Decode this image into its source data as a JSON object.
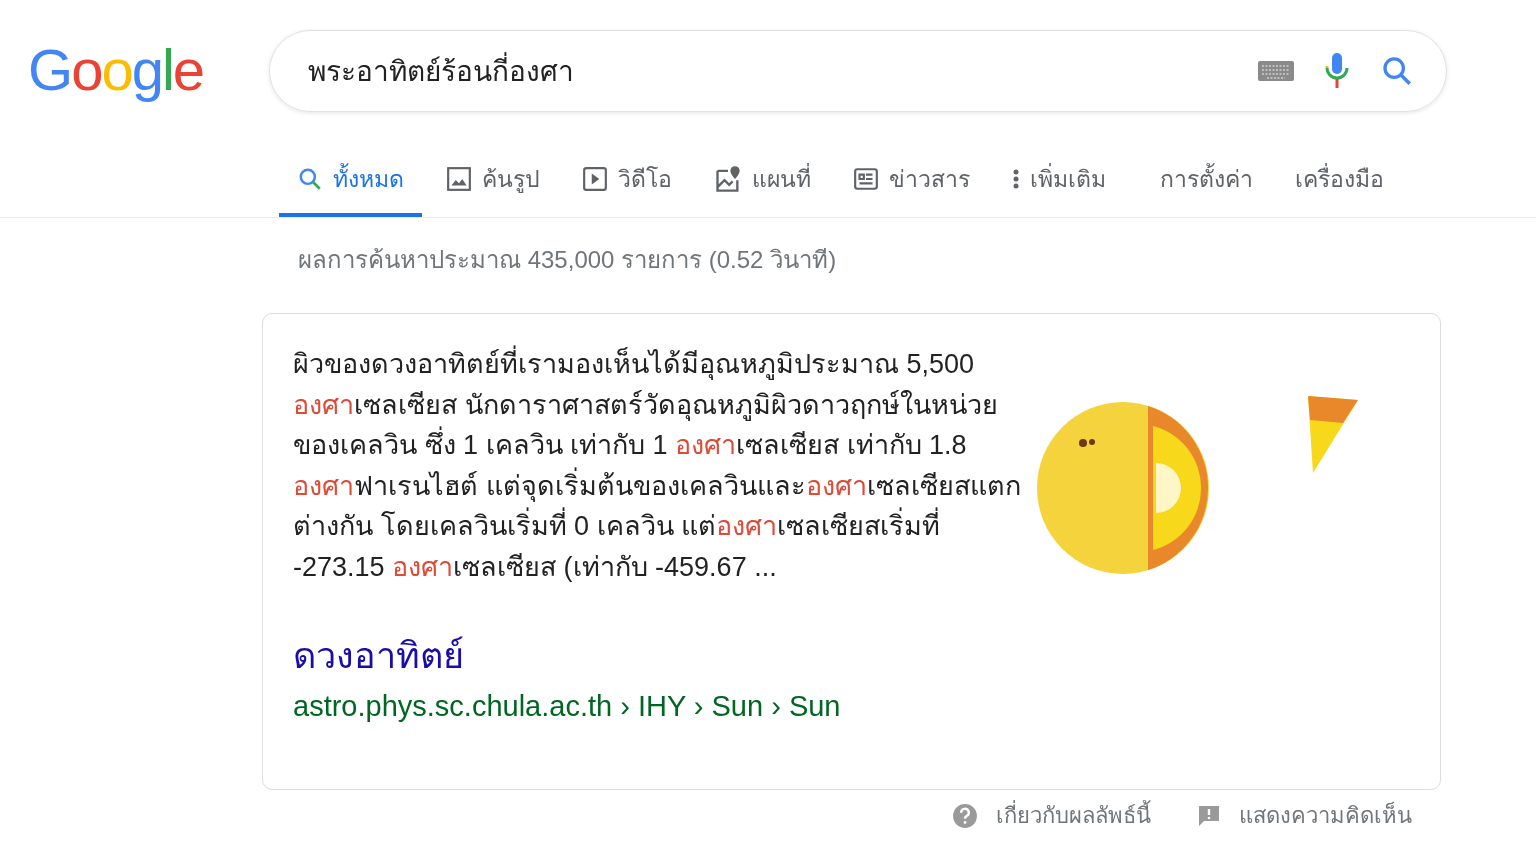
{
  "logo": {
    "text": "Google"
  },
  "search": {
    "value": "พระอาทิตย์ร้อนกี่องศา"
  },
  "tabs": [
    {
      "label": "ทั้งหมด",
      "kind": "search",
      "selected": true
    },
    {
      "label": "ค้นรูป",
      "kind": "images",
      "selected": false
    },
    {
      "label": "วิดีโอ",
      "kind": "videos",
      "selected": false
    },
    {
      "label": "แผนที่",
      "kind": "maps",
      "selected": false
    },
    {
      "label": "ข่าวสาร",
      "kind": "news",
      "selected": false
    },
    {
      "label": "เพิ่มเติม",
      "kind": "more",
      "selected": false
    },
    {
      "label": "การตั้งค่า",
      "kind": "plain",
      "selected": false
    },
    {
      "label": "เครื่องมือ",
      "kind": "plain",
      "selected": false
    }
  ],
  "result_stats": "ผลการค้นหาประมาณ 435,000 รายการ (0.52 วินาที)",
  "snippet": {
    "segments": [
      {
        "text": "ผิวของดวงอาทิตย์ที่เรามองเห็นได้มีอุณหภูมิประมาณ 5,500 ",
        "highlighted": false
      },
      {
        "text": "องศา",
        "highlighted": true
      },
      {
        "text": "เซลเซียส นักดาราศาสตร์วัดอุณหภูมิผิวดาวฤกษ์ในหน่วยของเคลวิน ซึ่ง 1 เคลวิน เท่ากับ 1 ",
        "highlighted": false
      },
      {
        "text": "องศา",
        "highlighted": true
      },
      {
        "text": "เซลเซียส เท่ากับ 1.8 ",
        "highlighted": false
      },
      {
        "text": "องศา",
        "highlighted": true
      },
      {
        "text": "ฟาเรนไฮต์ แต่จุดเริ่มต้นของเคลวินและ",
        "highlighted": false
      },
      {
        "text": "องศา",
        "highlighted": true
      },
      {
        "text": "เซลเซียสแตกต่างกัน โดยเคลวินเริ่มที่ 0 เคลวิน แต่",
        "highlighted": false
      },
      {
        "text": "องศา",
        "highlighted": true
      },
      {
        "text": "เซลเซียสเริ่มที่ -273.15 ",
        "highlighted": false
      },
      {
        "text": "องศา",
        "highlighted": true
      },
      {
        "text": "เซลเซียส (เท่ากับ -459.67 ...",
        "highlighted": false
      }
    ],
    "title": "ดวงอาทิตย์",
    "url": "astro.phys.sc.chula.ac.th › IHY › Sun › Sun"
  },
  "footer": [
    {
      "label": "เกี่ยวกับผลลัพธ์นี้",
      "kind": "help"
    },
    {
      "label": "แสดงความคิดเห็น",
      "kind": "feedback"
    }
  ]
}
